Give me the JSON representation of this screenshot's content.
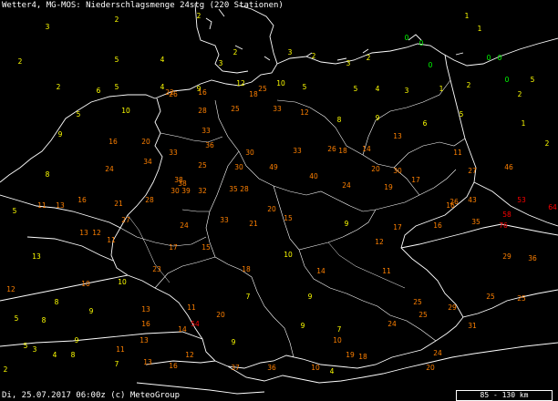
{
  "header": {
    "title": "Wetter4, MG-MOS: Niederschlagsmenge 24stg (220 Stationen)"
  },
  "footer": {
    "text": "Di, 25.07.2017 06:00z (c) MeteoGroup"
  },
  "scale": {
    "label": "85 - 130 km"
  },
  "colors": {
    "low": "#ffff00",
    "mid": "#ff8000",
    "high": "#ff0000",
    "green": "#00ff00",
    "border": "#ffffff",
    "background": "#000000"
  },
  "stations": [
    {
      "v": "2",
      "c": "low"
    },
    {
      "v": "2",
      "c": "low"
    },
    {
      "v": "1",
      "c": "low"
    },
    {
      "v": "1",
      "c": "low"
    },
    {
      "v": "0",
      "c": "green"
    },
    {
      "v": "0",
      "c": "green"
    },
    {
      "v": "3",
      "c": "low"
    },
    {
      "v": "2",
      "c": "low"
    },
    {
      "v": "5",
      "c": "low"
    },
    {
      "v": "4",
      "c": "low"
    },
    {
      "v": "2",
      "c": "low"
    },
    {
      "v": "3",
      "c": "low"
    },
    {
      "v": "2",
      "c": "low"
    },
    {
      "v": "3",
      "c": "low"
    },
    {
      "v": "3",
      "c": "low"
    },
    {
      "v": "2",
      "c": "low"
    },
    {
      "v": "0",
      "c": "green"
    },
    {
      "v": "0",
      "c": "green"
    },
    {
      "v": "0",
      "c": "green"
    },
    {
      "v": "0",
      "c": "green"
    },
    {
      "v": "2",
      "c": "low"
    },
    {
      "v": "5",
      "c": "low"
    },
    {
      "v": "4",
      "c": "low"
    },
    {
      "v": "6",
      "c": "low"
    },
    {
      "v": "9",
      "c": "low"
    },
    {
      "v": "12",
      "c": "low"
    },
    {
      "v": "10",
      "c": "low"
    },
    {
      "v": "5",
      "c": "low"
    },
    {
      "v": "5",
      "c": "low"
    },
    {
      "v": "4",
      "c": "low"
    },
    {
      "v": "3",
      "c": "low"
    },
    {
      "v": "1",
      "c": "low"
    },
    {
      "v": "2",
      "c": "low"
    },
    {
      "v": "2",
      "c": "low"
    },
    {
      "v": "5",
      "c": "low"
    },
    {
      "v": "22",
      "c": "mid"
    },
    {
      "v": "26",
      "c": "mid"
    },
    {
      "v": "16",
      "c": "mid"
    },
    {
      "v": "18",
      "c": "mid"
    },
    {
      "v": "25",
      "c": "mid"
    },
    {
      "v": "5",
      "c": "low"
    },
    {
      "v": "10",
      "c": "low"
    },
    {
      "v": "28",
      "c": "mid"
    },
    {
      "v": "25",
      "c": "mid"
    },
    {
      "v": "33",
      "c": "mid"
    },
    {
      "v": "12",
      "c": "mid"
    },
    {
      "v": "8",
      "c": "low"
    },
    {
      "v": "9",
      "c": "low"
    },
    {
      "v": "6",
      "c": "low"
    },
    {
      "v": "5",
      "c": "low"
    },
    {
      "v": "1",
      "c": "low"
    },
    {
      "v": "2",
      "c": "low"
    },
    {
      "v": "9",
      "c": "low"
    },
    {
      "v": "16",
      "c": "mid"
    },
    {
      "v": "20",
      "c": "mid"
    },
    {
      "v": "33",
      "c": "mid"
    },
    {
      "v": "36",
      "c": "mid"
    },
    {
      "v": "33",
      "c": "mid"
    },
    {
      "v": "26",
      "c": "mid"
    },
    {
      "v": "18",
      "c": "mid"
    },
    {
      "v": "14",
      "c": "mid"
    },
    {
      "v": "13",
      "c": "mid"
    },
    {
      "v": "11",
      "c": "mid"
    },
    {
      "v": "25",
      "c": "mid"
    },
    {
      "v": "33",
      "c": "mid"
    },
    {
      "v": "38",
      "c": "mid"
    },
    {
      "v": "30",
      "c": "mid"
    },
    {
      "v": "49",
      "c": "mid"
    },
    {
      "v": "40",
      "c": "mid"
    },
    {
      "v": "24",
      "c": "mid"
    },
    {
      "v": "30",
      "c": "mid"
    },
    {
      "v": "20",
      "c": "mid"
    },
    {
      "v": "30",
      "c": "mid"
    },
    {
      "v": "46",
      "c": "mid"
    },
    {
      "v": "27",
      "c": "mid"
    },
    {
      "v": "8",
      "c": "low"
    },
    {
      "v": "24",
      "c": "mid"
    },
    {
      "v": "34",
      "c": "mid"
    },
    {
      "v": "38",
      "c": "mid"
    },
    {
      "v": "30",
      "c": "mid"
    },
    {
      "v": "39",
      "c": "mid"
    },
    {
      "v": "35",
      "c": "mid"
    },
    {
      "v": "28",
      "c": "mid"
    },
    {
      "v": "32",
      "c": "mid"
    },
    {
      "v": "19",
      "c": "mid"
    },
    {
      "v": "17",
      "c": "mid"
    },
    {
      "v": "16",
      "c": "mid"
    },
    {
      "v": "26",
      "c": "mid"
    },
    {
      "v": "43",
      "c": "mid"
    },
    {
      "v": "53",
      "c": "high"
    },
    {
      "v": "64",
      "c": "high"
    },
    {
      "v": "11",
      "c": "mid"
    },
    {
      "v": "13",
      "c": "mid"
    },
    {
      "v": "16",
      "c": "mid"
    },
    {
      "v": "21",
      "c": "mid"
    },
    {
      "v": "28",
      "c": "mid"
    },
    {
      "v": "20",
      "c": "mid"
    },
    {
      "v": "15",
      "c": "mid"
    },
    {
      "v": "17",
      "c": "mid"
    },
    {
      "v": "16",
      "c": "mid"
    },
    {
      "v": "35",
      "c": "mid"
    },
    {
      "v": "58",
      "c": "high"
    },
    {
      "v": "76",
      "c": "high"
    },
    {
      "v": "27",
      "c": "mid"
    },
    {
      "v": "24",
      "c": "mid"
    },
    {
      "v": "33",
      "c": "mid"
    },
    {
      "v": "21",
      "c": "mid"
    },
    {
      "v": "9",
      "c": "low"
    },
    {
      "v": "12",
      "c": "mid"
    },
    {
      "v": "13",
      "c": "mid"
    },
    {
      "v": "11",
      "c": "mid"
    },
    {
      "v": "5",
      "c": "low"
    },
    {
      "v": "17",
      "c": "mid"
    },
    {
      "v": "15",
      "c": "mid"
    },
    {
      "v": "10",
      "c": "low"
    },
    {
      "v": "13",
      "c": "low"
    },
    {
      "v": "12",
      "c": "mid"
    },
    {
      "v": "29",
      "c": "mid"
    },
    {
      "v": "36",
      "c": "mid"
    },
    {
      "v": "23",
      "c": "mid"
    },
    {
      "v": "18",
      "c": "mid"
    },
    {
      "v": "14",
      "c": "mid"
    },
    {
      "v": "11",
      "c": "mid"
    },
    {
      "v": "10",
      "c": "low"
    },
    {
      "v": "12",
      "c": "mid"
    },
    {
      "v": "7",
      "c": "low"
    },
    {
      "v": "9",
      "c": "low"
    },
    {
      "v": "10",
      "c": "mid"
    },
    {
      "v": "8",
      "c": "low"
    },
    {
      "v": "25",
      "c": "mid"
    },
    {
      "v": "29",
      "c": "mid"
    },
    {
      "v": "25",
      "c": "mid"
    },
    {
      "v": "25",
      "c": "mid"
    },
    {
      "v": "54",
      "c": "high"
    },
    {
      "v": "11",
      "c": "mid"
    },
    {
      "v": "9",
      "c": "low"
    },
    {
      "v": "13",
      "c": "mid"
    },
    {
      "v": "16",
      "c": "mid"
    },
    {
      "v": "14",
      "c": "mid"
    },
    {
      "v": "20",
      "c": "mid"
    },
    {
      "v": "24",
      "c": "mid"
    },
    {
      "v": "25",
      "c": "mid"
    },
    {
      "v": "31",
      "c": "mid"
    },
    {
      "v": "13",
      "c": "mid"
    },
    {
      "v": "9",
      "c": "low"
    },
    {
      "v": "9",
      "c": "low"
    },
    {
      "v": "7",
      "c": "low"
    },
    {
      "v": "5",
      "c": "low"
    },
    {
      "v": "8",
      "c": "low"
    },
    {
      "v": "9",
      "c": "low"
    },
    {
      "v": "5",
      "c": "low"
    },
    {
      "v": "2",
      "c": "low"
    },
    {
      "v": "3",
      "c": "low"
    },
    {
      "v": "4",
      "c": "low"
    },
    {
      "v": "8",
      "c": "low"
    },
    {
      "v": "11",
      "c": "mid"
    },
    {
      "v": "13",
      "c": "mid"
    },
    {
      "v": "16",
      "c": "mid"
    },
    {
      "v": "12",
      "c": "mid"
    },
    {
      "v": "37",
      "c": "mid"
    },
    {
      "v": "36",
      "c": "mid"
    },
    {
      "v": "10",
      "c": "mid"
    },
    {
      "v": "19",
      "c": "mid"
    },
    {
      "v": "18",
      "c": "mid"
    },
    {
      "v": "10",
      "c": "mid"
    },
    {
      "v": "4",
      "c": "low"
    },
    {
      "v": "7",
      "c": "low"
    },
    {
      "v": "24",
      "c": "mid"
    },
    {
      "v": "20",
      "c": "mid"
    }
  ]
}
